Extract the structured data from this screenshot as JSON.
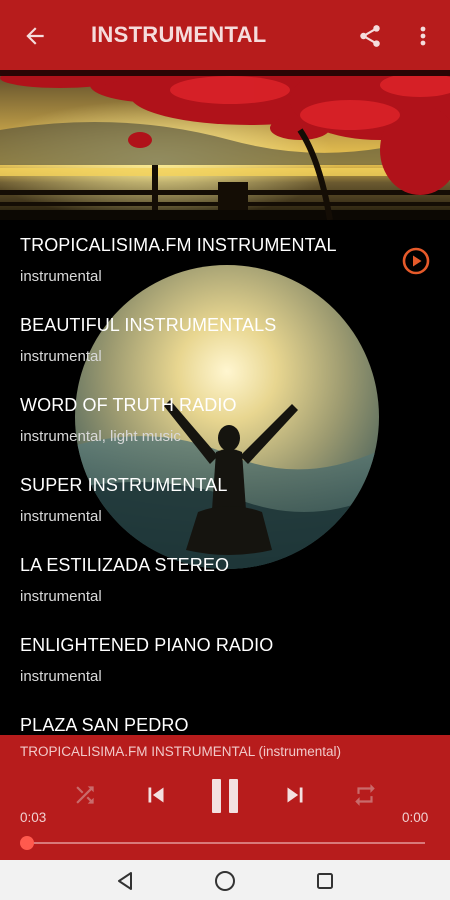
{
  "app_bar": {
    "title": "INSTRUMENTAL",
    "icons": [
      "arrow-back-icon",
      "share-icon",
      "more-vert-icon"
    ]
  },
  "stations": [
    {
      "name": "TROPICALISIMA.FM INSTRUMENTAL",
      "genre": "instrumental",
      "playing": true
    },
    {
      "name": "BEAUTIFUL INSTRUMENTALS",
      "genre": "instrumental"
    },
    {
      "name": "WORD OF TRUTH RADIO",
      "genre": "instrumental, light music"
    },
    {
      "name": "SUPER INSTRUMENTAL",
      "genre": "instrumental"
    },
    {
      "name": "LA ESTILIZADA STEREO",
      "genre": "instrumental"
    },
    {
      "name": "ENLIGHTENED PIANO RADIO",
      "genre": "instrumental"
    },
    {
      "name": "PLAZA SAN PEDRO",
      "genre": ""
    }
  ],
  "player": {
    "now_playing": "TROPICALISIMA.FM INSTRUMENTAL (instrumental)",
    "elapsed": "0:03",
    "duration": "0:00",
    "progress": 0,
    "controls": [
      "shuffle-icon",
      "skip-previous-icon",
      "pause-icon",
      "skip-next-icon",
      "repeat-icon"
    ]
  },
  "nav_bar": {
    "buttons": [
      "back-triangle-icon",
      "home-circle-icon",
      "recents-square-icon"
    ]
  },
  "colors": {
    "primary": "#b71c1c",
    "accent": "#ff5a4e",
    "play_icon": "#e65a2a"
  }
}
